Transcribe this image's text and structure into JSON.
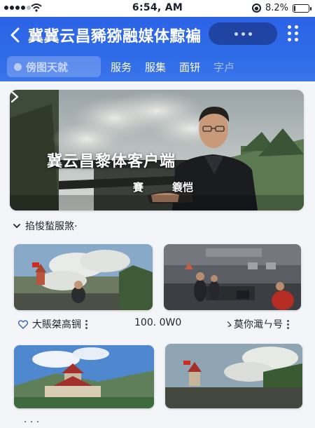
{
  "status_bar": {
    "time": "6:54, AM",
    "battery": "8.2%",
    "battery_level": 0.082
  },
  "header": {
    "title": "冀冀云昌豨猕融媒体黥褊",
    "tabs": [
      {
        "label": "傍图天就",
        "active": true
      },
      {
        "label": "服务"
      },
      {
        "label": "服集"
      },
      {
        "label": "面钘"
      },
      {
        "label": "字卢"
      }
    ]
  },
  "hero": {
    "title": "冀云昌黎体客户端",
    "caption_left": "賽",
    "caption_right": "簔恺"
  },
  "section": {
    "title": "掐悛蝵服煞·"
  },
  "cards": [
    {
      "label": "大賬桀高锎",
      "value": "100. 0W0"
    },
    {
      "label": "ゝ莫你濈ㄣ号"
    }
  ],
  "colors": {
    "header_blue": "#2f6be8",
    "background": "#f3f5f8"
  },
  "icons": {
    "back": "chevron-left-icon",
    "more": "more-dots-icon",
    "grid": "grid-dots-icon",
    "hero_next": "chevron-right-icon",
    "section_toggle": "chevron-down-icon",
    "like": "heart-icon",
    "card_more": "kebab-icon"
  }
}
